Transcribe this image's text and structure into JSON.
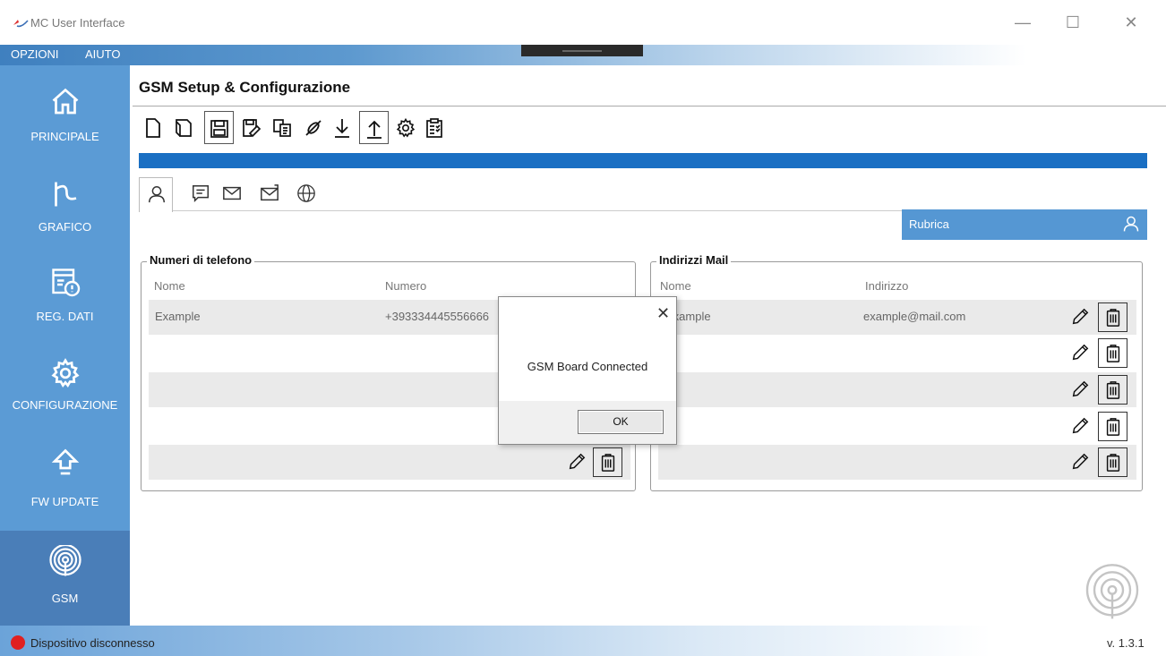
{
  "window": {
    "title": "MC User Interface",
    "min_glyph": "—",
    "max_glyph": "☐",
    "close_glyph": "✕"
  },
  "menu": {
    "items": [
      "OPZIONI",
      "AIUTO"
    ]
  },
  "sidebar": {
    "items": [
      {
        "label": "PRINCIPALE",
        "icon": "home-icon"
      },
      {
        "label": "GRAFICO",
        "icon": "chart-icon"
      },
      {
        "label": "REG. DATI",
        "icon": "data-log-icon"
      },
      {
        "label": "CONFIGURAZIONE",
        "icon": "gear-icon"
      },
      {
        "label": "FW UPDATE",
        "icon": "upload-arrow-icon"
      },
      {
        "label": "GSM",
        "icon": "antenna-icon",
        "active": true
      }
    ]
  },
  "main": {
    "title": "GSM Setup & Configurazione",
    "toolbar": [
      "new-file",
      "open-file",
      "save",
      "save-as",
      "copy",
      "disconnect",
      "download",
      "upload",
      "settings",
      "checklist"
    ],
    "tabs": [
      "contacts",
      "sms",
      "mail",
      "mail-config",
      "web"
    ],
    "rubrica_label": "Rubrica"
  },
  "phone_numbers": {
    "title": "Numeri di telefono",
    "columns": [
      "Nome",
      "Numero"
    ],
    "rows": [
      {
        "nome": "Example",
        "numero": "+393334445556666"
      }
    ]
  },
  "mail_addresses": {
    "title": "Indirizzi Mail",
    "columns": [
      "Nome",
      "Indirizzo"
    ],
    "rows": [
      {
        "nome": "Example",
        "indirizzo": "example@mail.com"
      }
    ]
  },
  "dialog": {
    "message": "GSM Board Connected",
    "ok_label": "OK",
    "close_glyph": "✕"
  },
  "status": {
    "text": "Dispositivo disconnesso",
    "version": "v. 1.3.1",
    "color": "#e02020"
  },
  "colors": {
    "sidebar": "#5b9bd5",
    "accent_strip": "#1a6fc3",
    "rubrica_header": "#5597d3"
  }
}
